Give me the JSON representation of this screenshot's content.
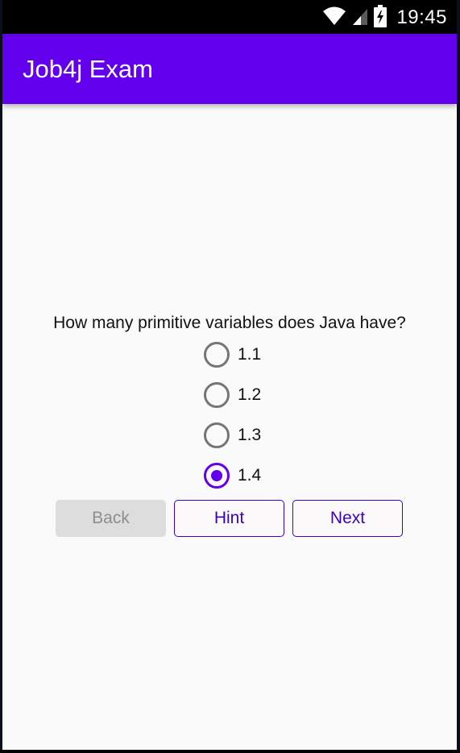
{
  "status_bar": {
    "time": "19:45",
    "icons": [
      "wifi-icon",
      "signal-icon",
      "battery-icon"
    ]
  },
  "app_bar": {
    "title": "Job4j Exam"
  },
  "exam": {
    "question": "How many primitive variables does Java have?",
    "options": [
      {
        "label": "1.1",
        "selected": false
      },
      {
        "label": "1.2",
        "selected": false
      },
      {
        "label": "1.3",
        "selected": false
      },
      {
        "label": "1.4",
        "selected": true
      }
    ],
    "buttons": {
      "back": "Back",
      "hint": "Hint",
      "next": "Next"
    }
  },
  "colors": {
    "primary": "#6200ee",
    "status_bar": "#000000",
    "button_outline": "#3a00c5",
    "disabled_button": "#dddddd",
    "background": "#fafafa"
  }
}
